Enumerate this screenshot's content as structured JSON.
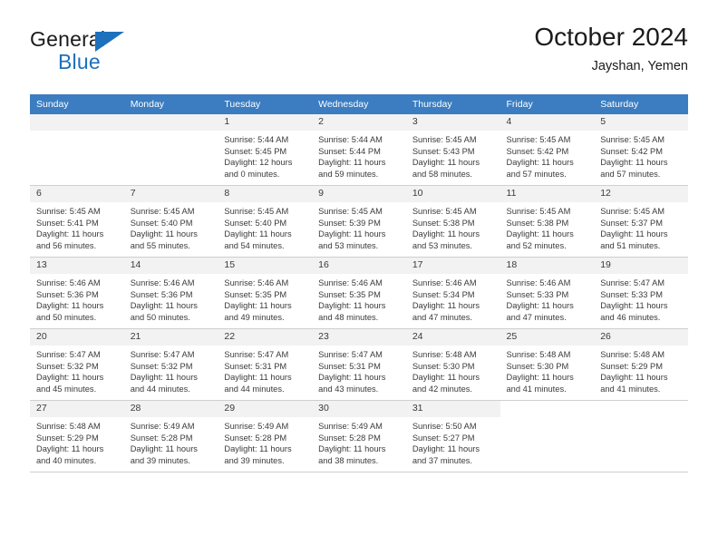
{
  "brand": {
    "name_top": "General",
    "name_bottom": "Blue",
    "accent_color": "#1d70bb",
    "triangle_icon": "triangle-icon"
  },
  "header": {
    "title": "October 2024",
    "subtitle": "Jayshan, Yemen"
  },
  "calendar": {
    "header_bg": "#3b7dc0",
    "weekdays": [
      "Sunday",
      "Monday",
      "Tuesday",
      "Wednesday",
      "Thursday",
      "Friday",
      "Saturday"
    ],
    "weeks": [
      [
        {
          "day": "",
          "sunrise": "",
          "sunset": "",
          "daylight": "",
          "empty": true
        },
        {
          "day": "",
          "sunrise": "",
          "sunset": "",
          "daylight": "",
          "empty": true
        },
        {
          "day": "1",
          "sunrise": "Sunrise: 5:44 AM",
          "sunset": "Sunset: 5:45 PM",
          "daylight": "Daylight: 12 hours and 0 minutes."
        },
        {
          "day": "2",
          "sunrise": "Sunrise: 5:44 AM",
          "sunset": "Sunset: 5:44 PM",
          "daylight": "Daylight: 11 hours and 59 minutes."
        },
        {
          "day": "3",
          "sunrise": "Sunrise: 5:45 AM",
          "sunset": "Sunset: 5:43 PM",
          "daylight": "Daylight: 11 hours and 58 minutes."
        },
        {
          "day": "4",
          "sunrise": "Sunrise: 5:45 AM",
          "sunset": "Sunset: 5:42 PM",
          "daylight": "Daylight: 11 hours and 57 minutes."
        },
        {
          "day": "5",
          "sunrise": "Sunrise: 5:45 AM",
          "sunset": "Sunset: 5:42 PM",
          "daylight": "Daylight: 11 hours and 57 minutes."
        }
      ],
      [
        {
          "day": "6",
          "sunrise": "Sunrise: 5:45 AM",
          "sunset": "Sunset: 5:41 PM",
          "daylight": "Daylight: 11 hours and 56 minutes."
        },
        {
          "day": "7",
          "sunrise": "Sunrise: 5:45 AM",
          "sunset": "Sunset: 5:40 PM",
          "daylight": "Daylight: 11 hours and 55 minutes."
        },
        {
          "day": "8",
          "sunrise": "Sunrise: 5:45 AM",
          "sunset": "Sunset: 5:40 PM",
          "daylight": "Daylight: 11 hours and 54 minutes."
        },
        {
          "day": "9",
          "sunrise": "Sunrise: 5:45 AM",
          "sunset": "Sunset: 5:39 PM",
          "daylight": "Daylight: 11 hours and 53 minutes."
        },
        {
          "day": "10",
          "sunrise": "Sunrise: 5:45 AM",
          "sunset": "Sunset: 5:38 PM",
          "daylight": "Daylight: 11 hours and 53 minutes."
        },
        {
          "day": "11",
          "sunrise": "Sunrise: 5:45 AM",
          "sunset": "Sunset: 5:38 PM",
          "daylight": "Daylight: 11 hours and 52 minutes."
        },
        {
          "day": "12",
          "sunrise": "Sunrise: 5:45 AM",
          "sunset": "Sunset: 5:37 PM",
          "daylight": "Daylight: 11 hours and 51 minutes."
        }
      ],
      [
        {
          "day": "13",
          "sunrise": "Sunrise: 5:46 AM",
          "sunset": "Sunset: 5:36 PM",
          "daylight": "Daylight: 11 hours and 50 minutes."
        },
        {
          "day": "14",
          "sunrise": "Sunrise: 5:46 AM",
          "sunset": "Sunset: 5:36 PM",
          "daylight": "Daylight: 11 hours and 50 minutes."
        },
        {
          "day": "15",
          "sunrise": "Sunrise: 5:46 AM",
          "sunset": "Sunset: 5:35 PM",
          "daylight": "Daylight: 11 hours and 49 minutes."
        },
        {
          "day": "16",
          "sunrise": "Sunrise: 5:46 AM",
          "sunset": "Sunset: 5:35 PM",
          "daylight": "Daylight: 11 hours and 48 minutes."
        },
        {
          "day": "17",
          "sunrise": "Sunrise: 5:46 AM",
          "sunset": "Sunset: 5:34 PM",
          "daylight": "Daylight: 11 hours and 47 minutes."
        },
        {
          "day": "18",
          "sunrise": "Sunrise: 5:46 AM",
          "sunset": "Sunset: 5:33 PM",
          "daylight": "Daylight: 11 hours and 47 minutes."
        },
        {
          "day": "19",
          "sunrise": "Sunrise: 5:47 AM",
          "sunset": "Sunset: 5:33 PM",
          "daylight": "Daylight: 11 hours and 46 minutes."
        }
      ],
      [
        {
          "day": "20",
          "sunrise": "Sunrise: 5:47 AM",
          "sunset": "Sunset: 5:32 PM",
          "daylight": "Daylight: 11 hours and 45 minutes."
        },
        {
          "day": "21",
          "sunrise": "Sunrise: 5:47 AM",
          "sunset": "Sunset: 5:32 PM",
          "daylight": "Daylight: 11 hours and 44 minutes."
        },
        {
          "day": "22",
          "sunrise": "Sunrise: 5:47 AM",
          "sunset": "Sunset: 5:31 PM",
          "daylight": "Daylight: 11 hours and 44 minutes."
        },
        {
          "day": "23",
          "sunrise": "Sunrise: 5:47 AM",
          "sunset": "Sunset: 5:31 PM",
          "daylight": "Daylight: 11 hours and 43 minutes."
        },
        {
          "day": "24",
          "sunrise": "Sunrise: 5:48 AM",
          "sunset": "Sunset: 5:30 PM",
          "daylight": "Daylight: 11 hours and 42 minutes."
        },
        {
          "day": "25",
          "sunrise": "Sunrise: 5:48 AM",
          "sunset": "Sunset: 5:30 PM",
          "daylight": "Daylight: 11 hours and 41 minutes."
        },
        {
          "day": "26",
          "sunrise": "Sunrise: 5:48 AM",
          "sunset": "Sunset: 5:29 PM",
          "daylight": "Daylight: 11 hours and 41 minutes."
        }
      ],
      [
        {
          "day": "27",
          "sunrise": "Sunrise: 5:48 AM",
          "sunset": "Sunset: 5:29 PM",
          "daylight": "Daylight: 11 hours and 40 minutes."
        },
        {
          "day": "28",
          "sunrise": "Sunrise: 5:49 AM",
          "sunset": "Sunset: 5:28 PM",
          "daylight": "Daylight: 11 hours and 39 minutes."
        },
        {
          "day": "29",
          "sunrise": "Sunrise: 5:49 AM",
          "sunset": "Sunset: 5:28 PM",
          "daylight": "Daylight: 11 hours and 39 minutes."
        },
        {
          "day": "30",
          "sunrise": "Sunrise: 5:49 AM",
          "sunset": "Sunset: 5:28 PM",
          "daylight": "Daylight: 11 hours and 38 minutes."
        },
        {
          "day": "31",
          "sunrise": "Sunrise: 5:50 AM",
          "sunset": "Sunset: 5:27 PM",
          "daylight": "Daylight: 11 hours and 37 minutes."
        },
        {
          "day": "",
          "sunrise": "",
          "sunset": "",
          "daylight": "",
          "blank": true
        },
        {
          "day": "",
          "sunrise": "",
          "sunset": "",
          "daylight": "",
          "blank": true
        }
      ]
    ]
  }
}
